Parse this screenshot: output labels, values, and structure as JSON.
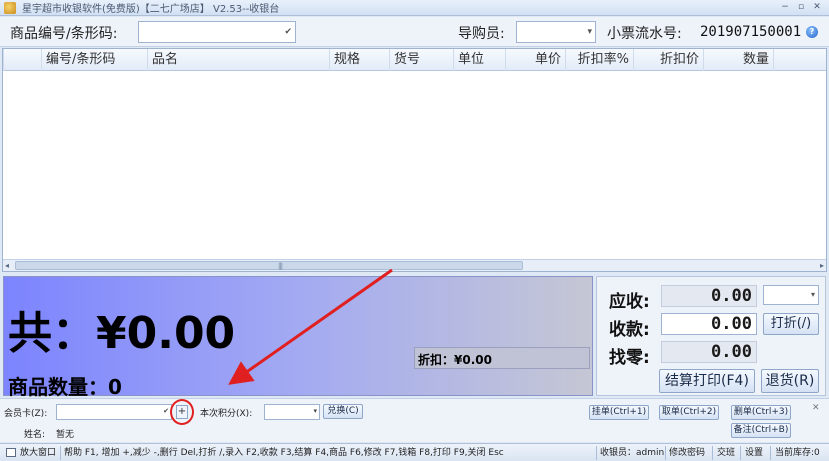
{
  "window": {
    "title": "星宇超市收银软件(免费版)【二七广场店】 V2.53--收银台",
    "controls": [
      "−",
      "▫",
      "✕"
    ]
  },
  "search": {
    "barcode_label": "商品编号/条形码:",
    "barcode_value": "",
    "guide_label": "导购员:",
    "guide_value": "",
    "serial_label": "小票流水号:",
    "serial_value": "201907150001",
    "help_glyph": "?"
  },
  "grid": {
    "columns": [
      "编号/条形码",
      "品名",
      "规格",
      "货号",
      "单位",
      "单价",
      "折扣率%",
      "折扣价",
      "数量"
    ],
    "rows": [],
    "scroll_left": "◂",
    "scroll_right": "▸",
    "scroll_grip": "|||"
  },
  "totals": {
    "total_label": "共：¥0.00",
    "qty_label": "商品数量：0",
    "discount_label": "折扣：¥0.00"
  },
  "payment": {
    "receivable_label": "应收:",
    "receivable_value": "0.00",
    "received_label": "收款:",
    "received_value": "0.00",
    "change_label": "找零:",
    "change_value": "0.00",
    "discount_button": "打折(/)",
    "checkout_button": "结算打印(F4)",
    "return_button": "退货(R)"
  },
  "member": {
    "card_label": "会员卡(Z):",
    "card_value": "",
    "plus_label": "+",
    "points_label": "本次积分(X):",
    "points_value": "",
    "redeem_button": "兑换(C)",
    "name_label": "姓名:",
    "name_value": "暂无",
    "hold_button": "挂单(Ctrl+1)",
    "retrieve_button": "取单(Ctrl+2)",
    "delete_button": "删单(Ctrl+3)",
    "note_button": "备注(Ctrl+B)",
    "close_glyph": "✕"
  },
  "status": {
    "maximize_label": "放大窗口",
    "shortcuts": "帮助 F1, 增加 +,减少 -,删行 Del,打折 /,录入 F2,收款 F3,结算 F4,商品 F6,修改 F7,钱箱 F8,打印 F9,关闭 Esc",
    "cashier": "收银员：admin",
    "change_password": "修改密码",
    "shift": "交班",
    "settings": "设置",
    "stock": "当前库存:0"
  },
  "colors": {
    "total_gradient_start": "#7c84ff",
    "annotation": "#e02020"
  }
}
